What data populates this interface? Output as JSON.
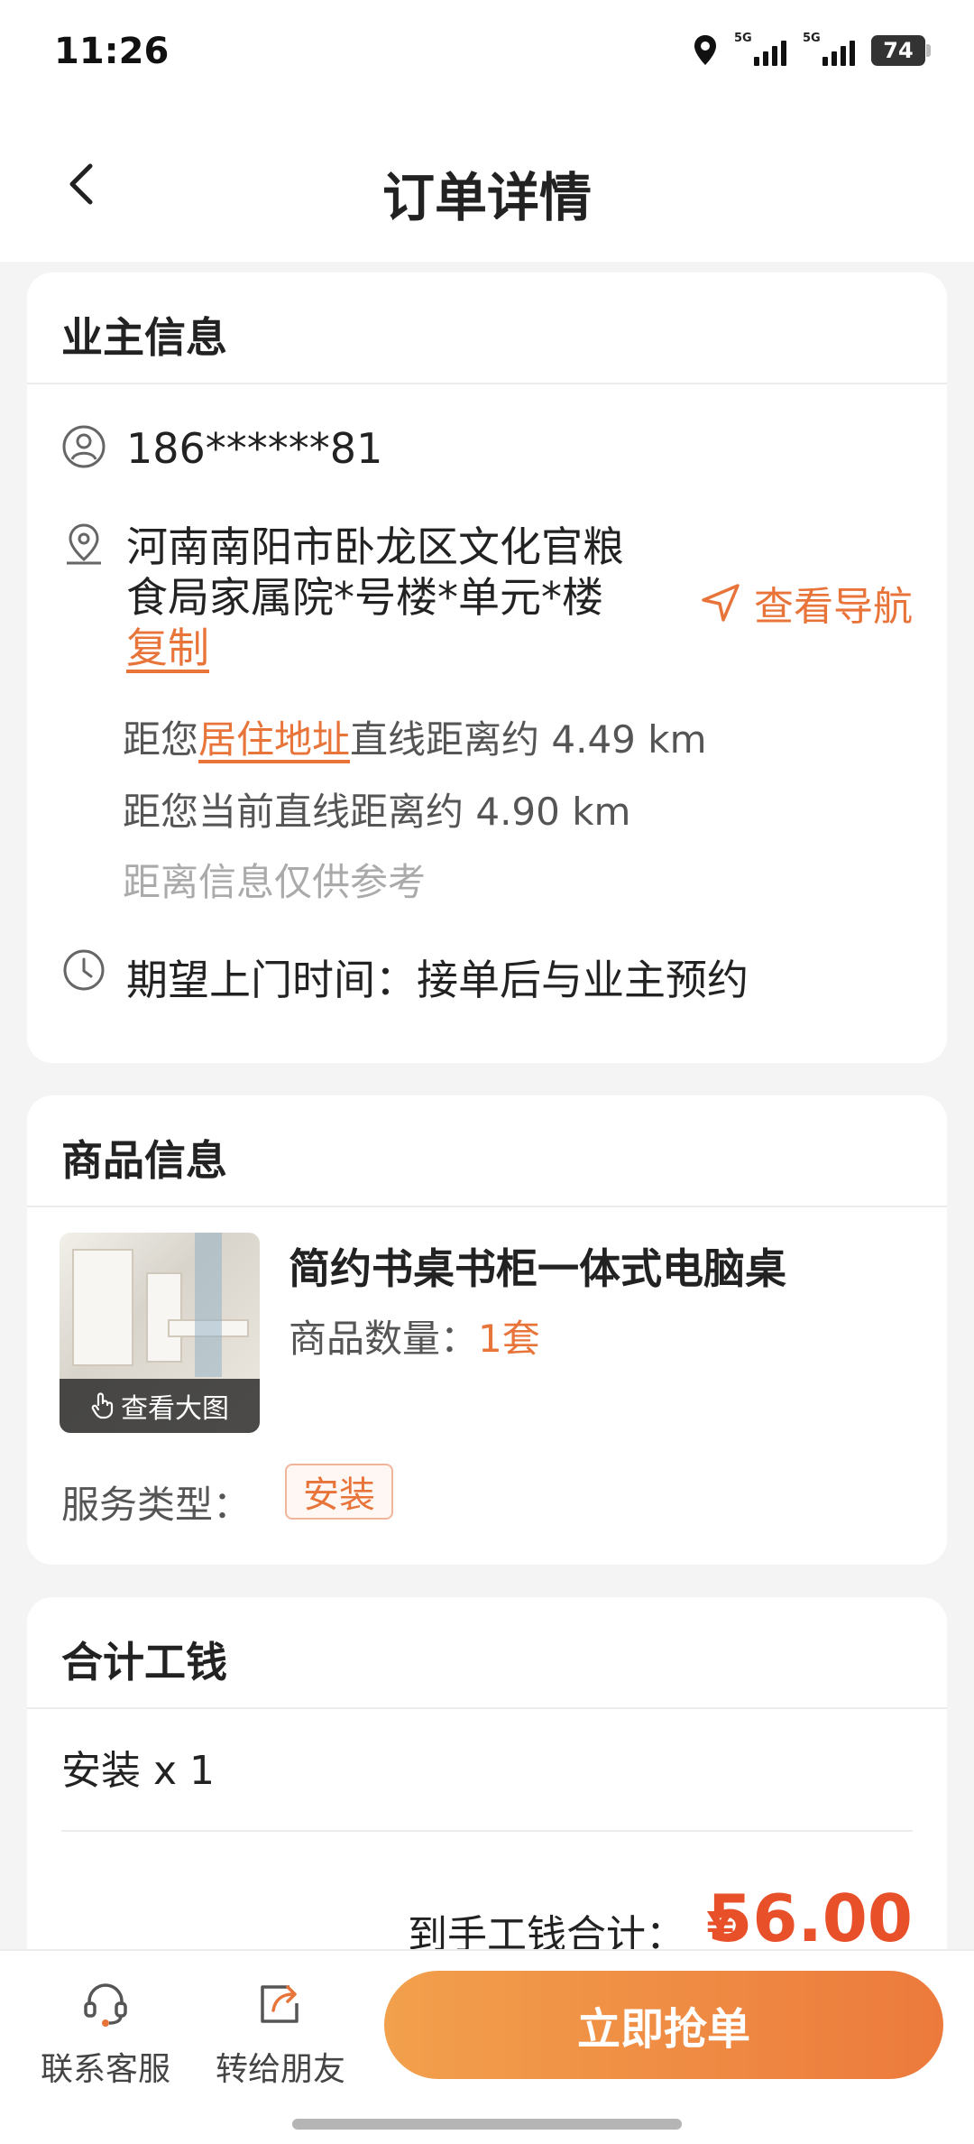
{
  "status": {
    "time": "11:26",
    "battery": "74",
    "net1": "5G",
    "net2": "5G"
  },
  "nav": {
    "title": "订单详情"
  },
  "owner": {
    "section_title": "业主信息",
    "phone": "186******81",
    "address_line1": "河南南阳市卧龙区文化官粮",
    "address_line2": "食局家属院*号楼*单元*楼",
    "copy_label": "复制",
    "navigate_label": "查看导航",
    "dist_prefix": "距您",
    "dist_link": "居住地址",
    "dist_suffix": "直线距离约 4.49 km",
    "dist_current": "距您当前直线距离约 4.90 km",
    "dist_note": "距离信息仅供参考",
    "expected_time": "期望上门时间：接单后与业主预约"
  },
  "product": {
    "section_title": "商品信息",
    "name": "简约书桌书柜一体式电脑桌",
    "qty_label": "商品数量：",
    "qty_value": "1套",
    "view_image": "查看大图",
    "service_label": "服务类型：",
    "service_value": "安装"
  },
  "fees": {
    "section_title": "合计工钱",
    "item": "安装 x 1",
    "total_label": "到手工钱合计：",
    "currency": "¥",
    "total_value": "56.00"
  },
  "bottom": {
    "service_label": "联系客服",
    "share_label": "转给朋友",
    "grab_label": "立即抢单"
  },
  "colors": {
    "accent": "#e8743a",
    "price": "#e8502a"
  }
}
